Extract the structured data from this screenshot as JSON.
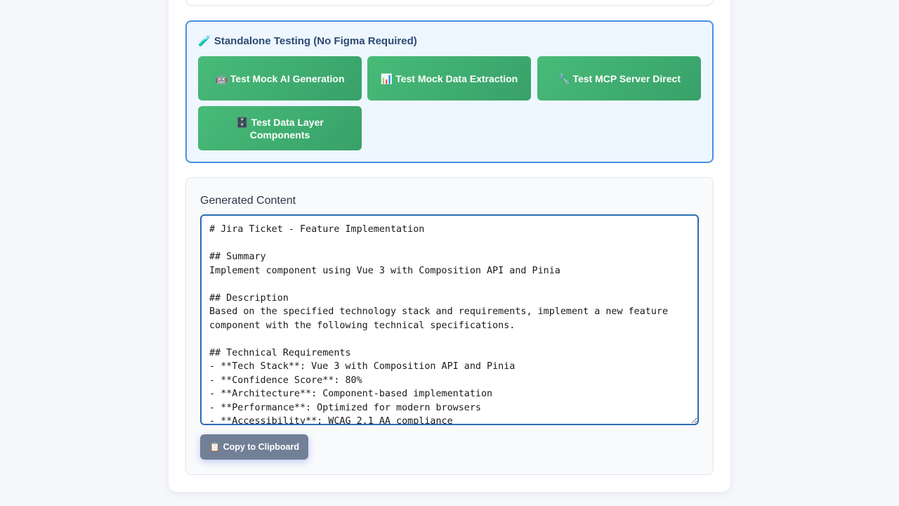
{
  "testing": {
    "title": "🧪 Standalone Testing (No Figma Required)",
    "buttons": [
      {
        "icon": "🤖",
        "label": "Test Mock AI Generation"
      },
      {
        "icon": "📊",
        "label": "Test Mock Data Extraction"
      },
      {
        "icon": "🔧",
        "label": "Test MCP Server Direct"
      },
      {
        "icon": "🗄️",
        "label": "Test Data Layer Components"
      }
    ]
  },
  "content": {
    "title": "Generated Content",
    "text": "# Jira Ticket - Feature Implementation\n\n## Summary\nImplement component using Vue 3 with Composition API and Pinia\n\n## Description\nBased on the specified technology stack and requirements, implement a new feature component with the following technical specifications.\n\n## Technical Requirements\n- **Tech Stack**: Vue 3 with Composition API and Pinia\n- **Confidence Score**: 80%\n- **Architecture**: Component-based implementation\n- **Performance**: Optimized for modern browsers\n- **Accessibility**: WCAG 2.1 AA compliance",
    "copy_icon": "📋",
    "copy_label": "Copy to Clipboard"
  },
  "colors": {
    "accent_blue": "#4a90e2",
    "button_green": "#48bb78",
    "copy_gray": "#718096"
  }
}
